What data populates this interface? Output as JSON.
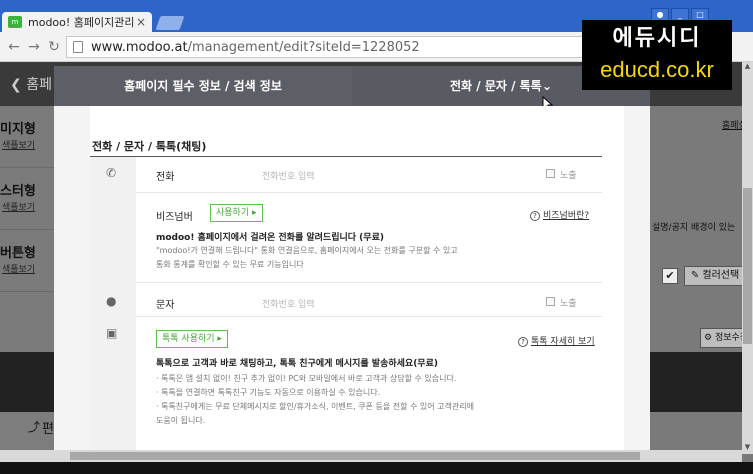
{
  "browser": {
    "tab_title": "modoo! 홈페이지관리",
    "tab_favicon": "modoo-favicon",
    "tab_close": "×",
    "url_host": "www.modoo.at",
    "url_path": "/management/edit?siteId=1228052"
  },
  "watermark": {
    "line1": "에듀시디",
    "line2": "educd.co.kr"
  },
  "background_page": {
    "back_label": "홈페",
    "left_items": [
      {
        "title": "미지형",
        "sub": "색플보기"
      },
      {
        "title": "스터형",
        "sub": "색플보기"
      },
      {
        "title": "버튼형",
        "sub": "색플보기"
      }
    ],
    "edit_label": "편",
    "right_link": "홈페설",
    "right_desc": "설명/공지 배경이 있는",
    "color_button": "컬러선택",
    "info_button": "정보수정"
  },
  "modal": {
    "tabs": [
      {
        "label": "홈페이지 필수 정보 / 검색 정보"
      },
      {
        "label": "전화 / 문자 / 톡톡"
      }
    ],
    "section_title": "전화 / 문자 / 톡톡(채팅)",
    "phone": {
      "label": "전화",
      "placeholder": "전화번호 입력",
      "checkbox": "노출"
    },
    "bizcall": {
      "label": "비즈넘버",
      "button": "사용하기 ▸",
      "help": "비즈넘버란?",
      "desc_bold": "modoo! 홈페이지에서 걸려온 전화를 알려드립니다 (무료)",
      "desc1": "\"modoo!가 연결해 드립니다\" 통화 연결음으로, 홈페이지에서 오는 전화를 구분할 수 있고",
      "desc2": "통화 통계를 확인할 수 있는 무료 기능입니다"
    },
    "sms": {
      "label": "문자",
      "placeholder": "전화번호 입력",
      "checkbox": "노출"
    },
    "talktalk": {
      "button": "톡톡 사용하기 ▸",
      "help": "톡톡 자세히 보기",
      "desc_bold": "톡톡으로 고객과 바로 채팅하고, 톡톡 친구에게 메시지를 발송하세요(무료)",
      "bullets": [
        "· 톡톡은 앱 설치 없이! 친구 추가 없이! PC와 모바일에서 바로 고객과 상담할 수 있습니다.",
        "· 톡톡을 연결하면 톡톡친구 기능도 자동으로 이용하실 수 있습니다.",
        "· 톡톡친구에게는 무료 단체메시지로 할인/휴가소식, 이벤트, 쿠폰 등을 전할 수 있어 고객관리에",
        "  도움이 됩니다."
      ]
    }
  }
}
